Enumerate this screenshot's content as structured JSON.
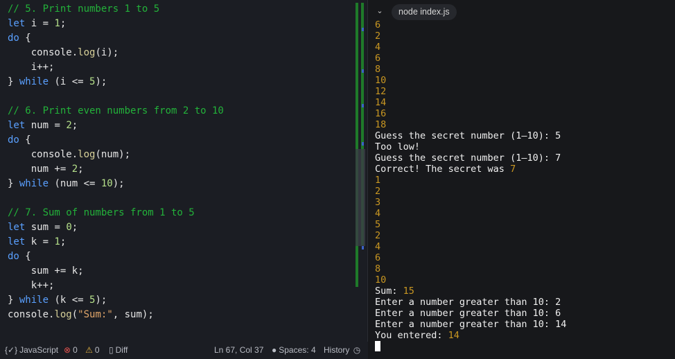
{
  "editor": {
    "lines": [
      [
        {
          "t": "// 5. Print numbers 1 to 5",
          "c": "comment"
        }
      ],
      [
        {
          "t": "let",
          "c": "kw"
        },
        {
          "t": " i = ",
          "c": "plain"
        },
        {
          "t": "1",
          "c": "num"
        },
        {
          "t": ";",
          "c": "plain"
        }
      ],
      [
        {
          "t": "do",
          "c": "kw"
        },
        {
          "t": " {",
          "c": "plain"
        }
      ],
      [
        {
          "t": "    console.",
          "c": "plain"
        },
        {
          "t": "log",
          "c": "fn"
        },
        {
          "t": "(i);",
          "c": "plain"
        }
      ],
      [
        {
          "t": "    i++;",
          "c": "plain"
        }
      ],
      [
        {
          "t": "} ",
          "c": "plain"
        },
        {
          "t": "while",
          "c": "kw"
        },
        {
          "t": " (i <= ",
          "c": "plain"
        },
        {
          "t": "5",
          "c": "num"
        },
        {
          "t": ");",
          "c": "plain"
        }
      ],
      [],
      [
        {
          "t": "// 6. Print even numbers from 2 to 10",
          "c": "comment"
        }
      ],
      [
        {
          "t": "let",
          "c": "kw"
        },
        {
          "t": " num = ",
          "c": "plain"
        },
        {
          "t": "2",
          "c": "num"
        },
        {
          "t": ";",
          "c": "plain"
        }
      ],
      [
        {
          "t": "do",
          "c": "kw"
        },
        {
          "t": " {",
          "c": "plain"
        }
      ],
      [
        {
          "t": "    console.",
          "c": "plain"
        },
        {
          "t": "log",
          "c": "fn"
        },
        {
          "t": "(num);",
          "c": "plain"
        }
      ],
      [
        {
          "t": "    num += ",
          "c": "plain"
        },
        {
          "t": "2",
          "c": "num"
        },
        {
          "t": ";",
          "c": "plain"
        }
      ],
      [
        {
          "t": "} ",
          "c": "plain"
        },
        {
          "t": "while",
          "c": "kw"
        },
        {
          "t": " (num <= ",
          "c": "plain"
        },
        {
          "t": "10",
          "c": "num"
        },
        {
          "t": ");",
          "c": "plain"
        }
      ],
      [],
      [
        {
          "t": "// 7. Sum of numbers from 1 to 5",
          "c": "comment"
        }
      ],
      [
        {
          "t": "let",
          "c": "kw"
        },
        {
          "t": " sum = ",
          "c": "plain"
        },
        {
          "t": "0",
          "c": "num"
        },
        {
          "t": ";",
          "c": "plain"
        }
      ],
      [
        {
          "t": "let",
          "c": "kw"
        },
        {
          "t": " k = ",
          "c": "plain"
        },
        {
          "t": "1",
          "c": "num"
        },
        {
          "t": ";",
          "c": "plain"
        }
      ],
      [
        {
          "t": "do",
          "c": "kw"
        },
        {
          "t": " {",
          "c": "plain"
        }
      ],
      [
        {
          "t": "    sum += k;",
          "c": "plain"
        }
      ],
      [
        {
          "t": "    k++;",
          "c": "plain"
        }
      ],
      [
        {
          "t": "} ",
          "c": "plain"
        },
        {
          "t": "while",
          "c": "kw"
        },
        {
          "t": " (k <= ",
          "c": "plain"
        },
        {
          "t": "5",
          "c": "num"
        },
        {
          "t": ");",
          "c": "plain"
        }
      ],
      [
        {
          "t": "console.",
          "c": "plain"
        },
        {
          "t": "log",
          "c": "fn"
        },
        {
          "t": "(",
          "c": "plain"
        },
        {
          "t": "\"Sum:\"",
          "c": "str"
        },
        {
          "t": ", sum);",
          "c": "plain"
        }
      ]
    ]
  },
  "terminal": {
    "tab_label": "node index.js",
    "chevron_icon": "chevron-down-icon",
    "lines": [
      [
        {
          "t": "6",
          "c": "n"
        }
      ],
      [
        {
          "t": "2",
          "c": "n"
        }
      ],
      [
        {
          "t": "4",
          "c": "n"
        }
      ],
      [
        {
          "t": "6",
          "c": "n"
        }
      ],
      [
        {
          "t": "8",
          "c": "n"
        }
      ],
      [
        {
          "t": "10",
          "c": "n"
        }
      ],
      [
        {
          "t": "12",
          "c": "n"
        }
      ],
      [
        {
          "t": "14",
          "c": "n"
        }
      ],
      [
        {
          "t": "16",
          "c": "n"
        }
      ],
      [
        {
          "t": "18",
          "c": "n"
        }
      ],
      [
        {
          "t": "Guess the secret number (1–10): 5",
          "c": "p"
        }
      ],
      [
        {
          "t": "Too low!",
          "c": "p"
        }
      ],
      [
        {
          "t": "Guess the secret number (1–10): 7",
          "c": "p"
        }
      ],
      [
        {
          "t": "Correct! The secret was ",
          "c": "p"
        },
        {
          "t": "7",
          "c": "n"
        }
      ],
      [
        {
          "t": "1",
          "c": "n"
        }
      ],
      [
        {
          "t": "2",
          "c": "n"
        }
      ],
      [
        {
          "t": "3",
          "c": "n"
        }
      ],
      [
        {
          "t": "4",
          "c": "n"
        }
      ],
      [
        {
          "t": "5",
          "c": "n"
        }
      ],
      [
        {
          "t": "2",
          "c": "n"
        }
      ],
      [
        {
          "t": "4",
          "c": "n"
        }
      ],
      [
        {
          "t": "6",
          "c": "n"
        }
      ],
      [
        {
          "t": "8",
          "c": "n"
        }
      ],
      [
        {
          "t": "10",
          "c": "n"
        }
      ],
      [
        {
          "t": "Sum: ",
          "c": "p"
        },
        {
          "t": "15",
          "c": "n"
        }
      ],
      [
        {
          "t": "Enter a number greater than 10: 2",
          "c": "p"
        }
      ],
      [
        {
          "t": "Enter a number greater than 10: 6",
          "c": "p"
        }
      ],
      [
        {
          "t": "Enter a number greater than 10: 14",
          "c": "p"
        }
      ],
      [
        {
          "t": "You entered: ",
          "c": "p"
        },
        {
          "t": "14",
          "c": "n"
        }
      ]
    ]
  },
  "statusbar": {
    "language": "JavaScript",
    "language_icon": "braces-icon",
    "errors": "0",
    "warnings": "0",
    "diff_label": "Diff",
    "cursor_position": "Ln 67, Col 37",
    "spaces": "Spaces: 4",
    "history_label": "History"
  },
  "colors": {
    "editor_bg": "#1b1d23",
    "terminal_bg": "#17181b",
    "comment": "#23b23a",
    "keyword": "#5aa0ff",
    "number": "#b5e08a",
    "terminal_number": "#c99722"
  }
}
